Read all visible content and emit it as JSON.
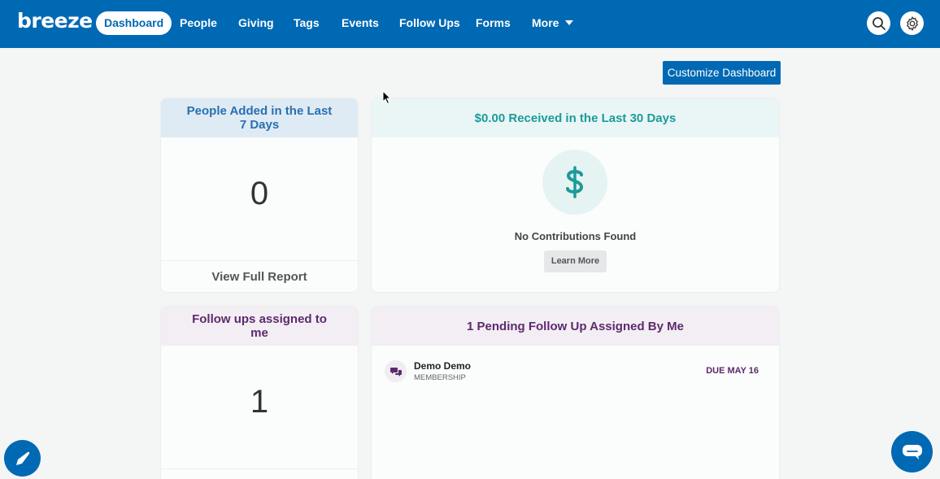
{
  "app": {
    "logo_text": "breeze"
  },
  "nav": {
    "items": [
      {
        "label": "Dashboard",
        "active": true
      },
      {
        "label": "People"
      },
      {
        "label": "Giving"
      },
      {
        "label": "Tags"
      },
      {
        "label": "Events"
      },
      {
        "label": "Follow Ups"
      },
      {
        "label": "Forms"
      },
      {
        "label": "More"
      }
    ],
    "icons": {
      "search": "search-icon",
      "settings": "gear-icon"
    }
  },
  "toolbar": {
    "customize_label": "Customize Dashboard"
  },
  "cards": {
    "people_added": {
      "title": "People Added in the Last 7 Days",
      "count": "0",
      "footer": "View Full Report"
    },
    "giving": {
      "title": "$0.00 Received in the Last 30 Days",
      "empty_text": "No Contributions Found",
      "learn_more": "Learn More",
      "icon": "dollar-icon"
    },
    "followups_assigned": {
      "title": "Follow ups assigned to me",
      "count": "1"
    },
    "pending_followups": {
      "title": "1 Pending Follow Up Assigned By Me",
      "items": [
        {
          "name": "Demo Demo",
          "type": "MEMBERSHIP",
          "due": "DUE MAY 16",
          "icon": "chat-bubbles-icon"
        }
      ]
    }
  },
  "colors": {
    "brand": "#0069b4",
    "teal": "#1d9a9a",
    "purple": "#5c2a6d",
    "blue_text": "#2a6fb0"
  }
}
